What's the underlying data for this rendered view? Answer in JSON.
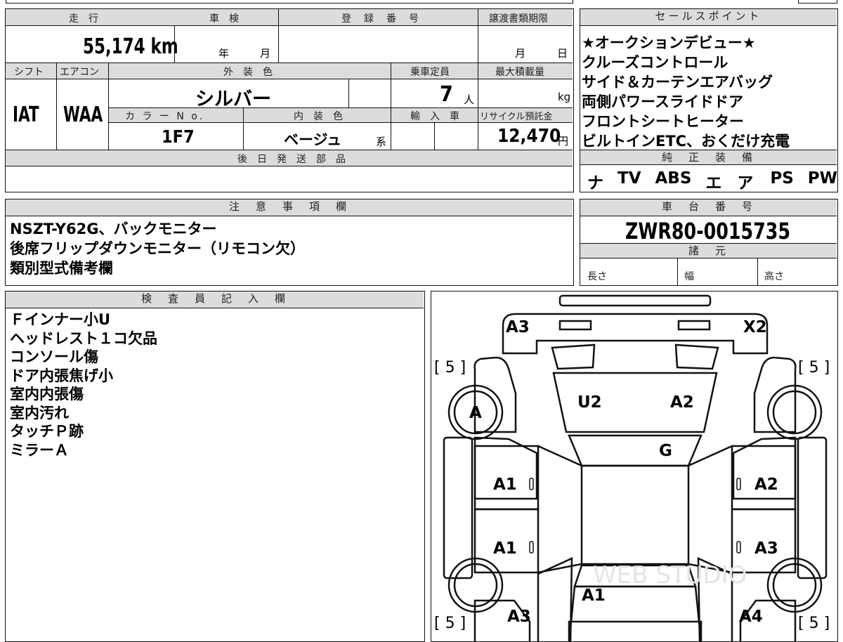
{
  "basic": {
    "h_mileage": "走　行",
    "h_shaken": "車　検",
    "h_reg": "登　録　番　号",
    "h_transfer": "譲渡書類期限",
    "mileage": "55,174 km",
    "year_unit": "年",
    "month_unit": "月",
    "transfer_month": "月",
    "transfer_day": "日",
    "h_shift": "シフト",
    "h_ac": "エアコン",
    "h_ext_color": "外　装　色",
    "h_capacity": "乗車定員",
    "h_maxload": "最大積載量",
    "shift": "IAT",
    "ac": "WAA",
    "ext_color": "シルバー",
    "capacity": "7",
    "capacity_unit": "人",
    "load_unit": "kg",
    "h_color_no": "カ ラ ー N o.",
    "h_int_color": "内　装　色",
    "h_import": "輸　入　車",
    "h_recycle": "リサイクル預託金",
    "color_no": "1F7",
    "int_color": "ベージュ",
    "int_suffix": "系",
    "recycle_fee": "12,470",
    "yen": "円",
    "h_later": "後　日　発　送　部　品"
  },
  "sales": {
    "header": "セールスポイント",
    "lines": [
      "★オークションデビュー★",
      "クルーズコントロール",
      "サイド＆カーテンエアバッグ",
      "両側パワースライドドア",
      "フロントシートヒーター",
      "ビルトインETC、おくだけ充電"
    ],
    "equip_header": "純　正　装　備",
    "equipment": [
      "ナビ",
      "TV",
      "ABS",
      "エアB",
      "アルミ",
      "PS",
      "PW"
    ]
  },
  "notes": {
    "header": "注　意　事　項　欄",
    "lines": [
      "NSZT-Y62G、バックモニター",
      "後席フリップダウンモニター（リモコン欠）",
      "類別型式備考欄"
    ]
  },
  "chassis": {
    "header": "車　台　番　号",
    "number": "ZWR80-0015735",
    "spec_header": "諸　元",
    "length": "長さ",
    "width": "幅",
    "height": "高さ"
  },
  "inspector": {
    "header": "検　査　員　記　入　欄",
    "lines": [
      "Ｆインナー小U",
      "ヘッドレスト１コ欠品",
      "コンソール傷",
      "ドア内張焦げ小",
      "室内内張傷",
      "室内汚れ",
      "タッチＰ跡",
      "ミラーＡ"
    ]
  },
  "diagram": {
    "marks": {
      "front_left": "A3",
      "front_right": "X2",
      "hood_left": "U2",
      "hood_right": "A2",
      "windshield": "G",
      "front_wheel_left": "A",
      "door_front_left": "A1",
      "door_front_right": "A2",
      "door_rear_left": "A1",
      "door_rear_right": "A3",
      "rear_center": "A1",
      "rear_left": "A3",
      "rear_right": "A4"
    },
    "tire_tread": [
      "[ 5 ]",
      "[ 5 ]",
      "[ 5 ]",
      "[ 5 ]"
    ],
    "watermark": "WEB STUDIO"
  }
}
